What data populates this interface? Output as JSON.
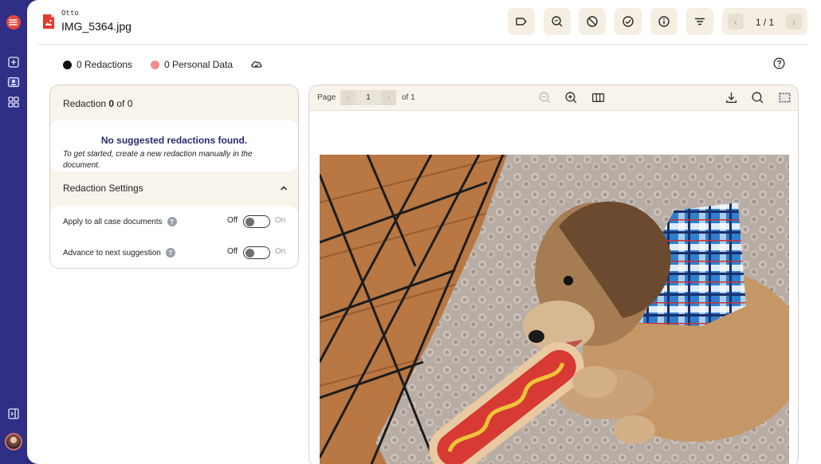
{
  "sidebar": {
    "logo_icon": "app-logo-icon",
    "nav": [
      "add-document-icon",
      "contact-card-icon",
      "apps-grid-icon"
    ],
    "collapse_icon": "sidebar-toggle-icon",
    "avatar_icon": "user-avatar"
  },
  "document": {
    "owner": "Otto",
    "file_name": "IMG_5364.jpg",
    "file_icon": "image-file-icon"
  },
  "toolbar": {
    "buttons": [
      "tag-icon",
      "search-redact-icon",
      "block-icon",
      "check-circle-icon",
      "info-icon",
      "filter-icon"
    ],
    "pager": {
      "prev_icon": "chevron-left-icon",
      "text": "1 / 1",
      "next_icon": "chevron-right-icon"
    }
  },
  "legend": {
    "redactions": "0 Redactions",
    "personal_data": "0 Personal Data",
    "redaction_color": "#111111",
    "personal_color": "#f08f8a",
    "cloud_icon": "cloud-sync-icon",
    "help_icon": "help-circle-icon"
  },
  "redaction_panel": {
    "label": "Redaction",
    "current": "0",
    "of_label": "of",
    "total": "0",
    "empty_title": "No suggested redactions found.",
    "empty_subtitle": "To get started, create a new redaction manually in the document.",
    "settings_title": "Redaction Settings",
    "settings": [
      {
        "label": "Apply to all case documents",
        "off": "Off",
        "on": "On",
        "value": "off"
      },
      {
        "label": "Advance to next suggestion",
        "off": "Off",
        "on": "On",
        "value": "off"
      }
    ]
  },
  "viewer": {
    "page_label": "Page",
    "page_number": "1",
    "of_label": "of 1",
    "tools": [
      "zoom-out-icon",
      "zoom-in-icon",
      "columns-icon",
      "download-icon",
      "search-icon",
      "area-select-icon"
    ],
    "image_subject": "puppy-chewing-hotdog-toy"
  }
}
